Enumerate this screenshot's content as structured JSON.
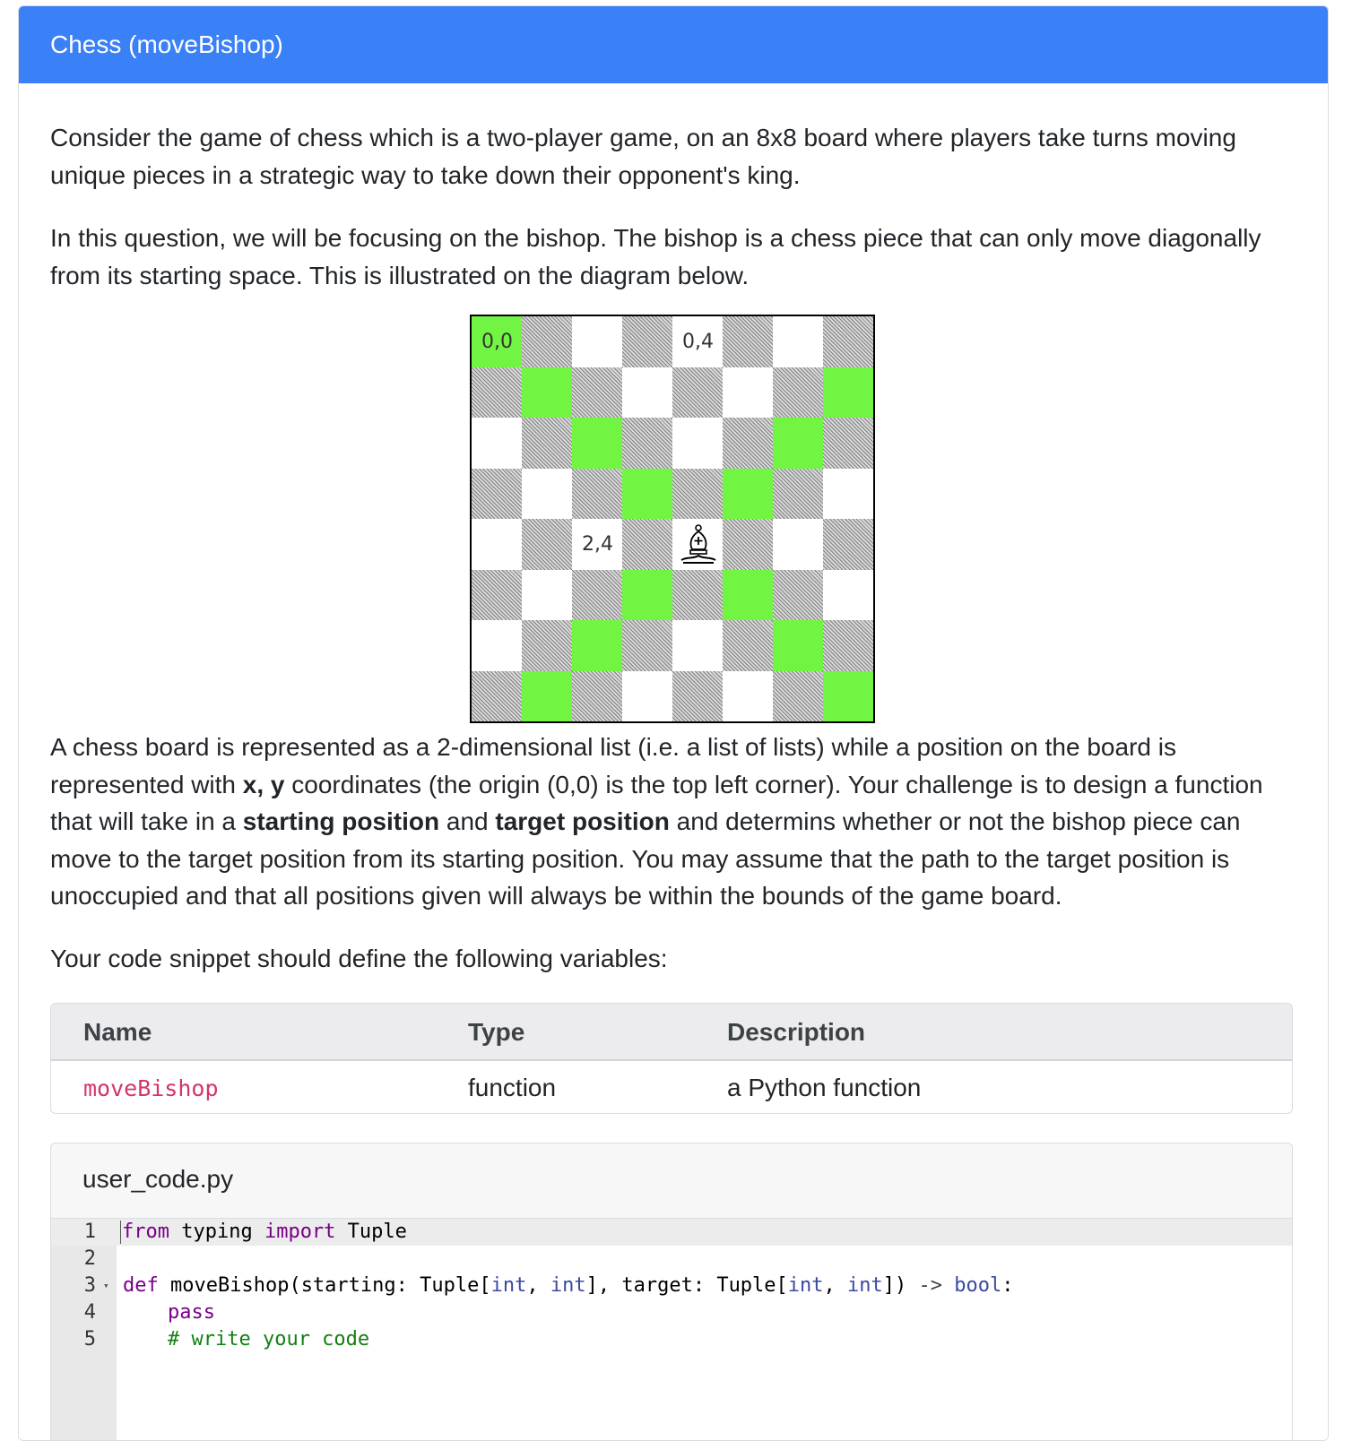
{
  "header": {
    "title": "Chess (moveBishop)"
  },
  "intro": {
    "p1": "Consider the game of chess which is a two-player game, on an 8x8 board where players take turns moving unique pieces in a strategic way to take down their opponent's king.",
    "p2": "In this question, we will be focusing on the bishop. The bishop is a chess piece that can only move diagonally from its starting space. This is illustrated on the diagram below."
  },
  "board": {
    "rows": [
      [
        "g",
        "d",
        "w",
        "d",
        "w",
        "d",
        "w",
        "d"
      ],
      [
        "d",
        "g",
        "d",
        "w",
        "d",
        "w",
        "d",
        "g"
      ],
      [
        "w",
        "d",
        "g",
        "d",
        "w",
        "d",
        "g",
        "d"
      ],
      [
        "d",
        "w",
        "d",
        "g",
        "d",
        "g",
        "d",
        "w"
      ],
      [
        "w",
        "d",
        "w",
        "d",
        "w",
        "d",
        "w",
        "d"
      ],
      [
        "d",
        "w",
        "d",
        "g",
        "d",
        "g",
        "d",
        "w"
      ],
      [
        "w",
        "d",
        "g",
        "d",
        "w",
        "d",
        "g",
        "d"
      ],
      [
        "d",
        "g",
        "d",
        "w",
        "d",
        "w",
        "d",
        "g"
      ]
    ],
    "labels": {
      "origin": "0,0",
      "top_mid": "0,4",
      "mid_left": "2,4"
    },
    "piece": "bishop-icon",
    "colors": {
      "highlight": "#72f542",
      "light": "#ffffff",
      "dark_hatch": "#808080"
    }
  },
  "body": {
    "p3_a": "A chess board is represented as a 2-dimensional list (i.e. a list of lists) while a position on the board is represented with ",
    "p3_xy": "x, y",
    "p3_b": " coordinates (the origin (0,0) is the top left corner). Your challenge is to design a function that will take in a ",
    "p3_start": "starting position",
    "p3_c": " and ",
    "p3_target": "target position",
    "p3_d": " and determins whether or not the bishop piece can move to the target position from its starting position. You may assume that the path to the target position is unoccupied and that all positions given will always be within the bounds of the game board.",
    "p4": "Your code snippet should define the following variables:"
  },
  "variables_table": {
    "headers": {
      "name": "Name",
      "type": "Type",
      "description": "Description"
    },
    "rows": [
      {
        "name": "moveBishop",
        "type": "function",
        "description": "a Python function"
      }
    ]
  },
  "editor": {
    "filename": "user_code.py",
    "line_numbers": [
      "1",
      "2",
      "3",
      "4",
      "5"
    ],
    "l1_kw1": "from",
    "l1_mid": " typing ",
    "l1_kw2": "import",
    "l1_end": " Tuple",
    "l3_kw": "def",
    "l3_a": " moveBishop(starting: Tuple[",
    "l3_int1": "int",
    "l3_b": ", ",
    "l3_int2": "int",
    "l3_c": "], target: Tuple[",
    "l3_int3": "int",
    "l3_d": ", ",
    "l3_int4": "int",
    "l3_e": "]) ",
    "l3_arrow": "->",
    "l3_ret": " bool",
    "l3_end": ":",
    "l4_kw": "pass",
    "l5_comment": "# write your code"
  }
}
